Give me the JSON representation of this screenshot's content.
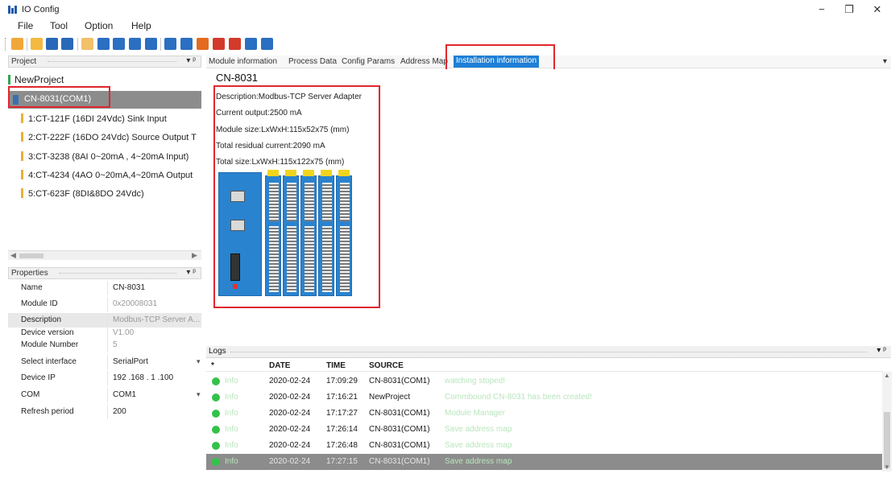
{
  "window": {
    "title": "IO Config",
    "minimize": "−",
    "maximize": "❐",
    "close": "✕"
  },
  "menu": [
    "File",
    "Tool",
    "Option",
    "Help"
  ],
  "toolbar": {
    "buttons": [
      {
        "icon": "wizard-icon",
        "color": "#f0a83a"
      },
      {
        "icon": "open-folder-icon",
        "color": "#f3b940"
      },
      {
        "icon": "save-icon",
        "color": "#2868b8"
      },
      {
        "icon": "save-as-icon",
        "color": "#2868b8"
      },
      {
        "icon": "settings-icon",
        "color": "#f2c06a"
      },
      {
        "icon": "search-icon",
        "color": "#2b6fc2"
      },
      {
        "icon": "download-icon",
        "color": "#2b6fc2"
      },
      {
        "icon": "stop-icon",
        "color": "#2b6fc2"
      },
      {
        "icon": "play-icon",
        "color": "#2b6fc2"
      },
      {
        "icon": "layout-icon",
        "color": "#2b6fc2"
      },
      {
        "icon": "monitor-icon",
        "color": "#2b6fc2"
      },
      {
        "icon": "power-icon",
        "color": "#e46b1e"
      },
      {
        "icon": "export-icon",
        "color": "#d33a2b"
      },
      {
        "icon": "delete-icon",
        "color": "#d33a2b"
      },
      {
        "icon": "comment-icon",
        "color": "#2b6fc2"
      },
      {
        "icon": "window-icon",
        "color": "#2b6fc2"
      }
    ]
  },
  "project_pane": {
    "header": "Project",
    "pin": "▾ ᵖ",
    "root": "NewProject",
    "selected": "CN-8031(COM1)",
    "children": [
      "1:CT-121F (16DI 24Vdc) Sink Input",
      "2:CT-222F (16DO 24Vdc) Source Output T",
      "3:CT-3238 (8AI 0~20mA , 4~20mA Input)",
      "4:CT-4234 (4AO 0~20mA,4~20mA Output",
      "5:CT-623F (8DI&8DO 24Vdc)"
    ],
    "scroll_left": "◀",
    "scroll_right": "▶"
  },
  "properties_pane": {
    "header": "Properties",
    "pin": "▾ ᵖ",
    "rows": [
      {
        "key": "Name",
        "value": "CN-8031"
      },
      {
        "key": "Module ID",
        "value": "0x20008031"
      },
      {
        "key": "Description",
        "value": "Modbus-TCP Server A..."
      },
      {
        "key": "Device version",
        "value": "V1.00"
      },
      {
        "key": "Module Number",
        "value": "5"
      },
      {
        "key": "Select interface",
        "value": "SerialPort"
      },
      {
        "key": "Device IP",
        "value": "192 .168 . 1 .100"
      },
      {
        "key": "COM",
        "value": "COM1"
      },
      {
        "key": "Refresh period",
        "value": "200"
      }
    ],
    "dropdown_glyph": "▾"
  },
  "tabs": [
    "Module information",
    "Process Data",
    "Config Params",
    "Address Map",
    "Installation information"
  ],
  "tabs_overflow": "▾",
  "installation": {
    "title": "CN-8031",
    "lines": [
      "Description:Modbus-TCP Server Adapter",
      "Current output:2500 mA",
      "Module size:LxWxH:115x52x75 (mm)",
      "Total residual current:2090 mA",
      "Total size:LxWxH:115x122x75 (mm)"
    ]
  },
  "logs": {
    "header": "Logs",
    "pin": "▾ ᵖ",
    "columns": [
      "*",
      "DATE",
      "TIME",
      "SOURCE"
    ],
    "rows": [
      {
        "level": "Info",
        "date": "2020-02-24",
        "time": "17:09:29",
        "source": "CN-8031(COM1)",
        "message": "watching stoped!"
      },
      {
        "level": "Info",
        "date": "2020-02-24",
        "time": "17:16:21",
        "source": "NewProject",
        "message": "Commbound CN-8031 has been created!"
      },
      {
        "level": "Info",
        "date": "2020-02-24",
        "time": "17:17:27",
        "source": "CN-8031(COM1)",
        "message": "Module Manager"
      },
      {
        "level": "Info",
        "date": "2020-02-24",
        "time": "17:26:14",
        "source": "CN-8031(COM1)",
        "message": "Save address map"
      },
      {
        "level": "Info",
        "date": "2020-02-24",
        "time": "17:26:48",
        "source": "CN-8031(COM1)",
        "message": "Save address map"
      },
      {
        "level": "Info",
        "date": "2020-02-24",
        "time": "17:27:15",
        "source": "CN-8031(COM1)",
        "message": "Save address map"
      }
    ],
    "scroll_up": "▲",
    "scroll_down": "▼"
  },
  "colors": {
    "accent": "#1e7fd6",
    "highlight_box": "#e0262d",
    "info_dot": "#34c24a",
    "selection": "#8c8c8c"
  }
}
